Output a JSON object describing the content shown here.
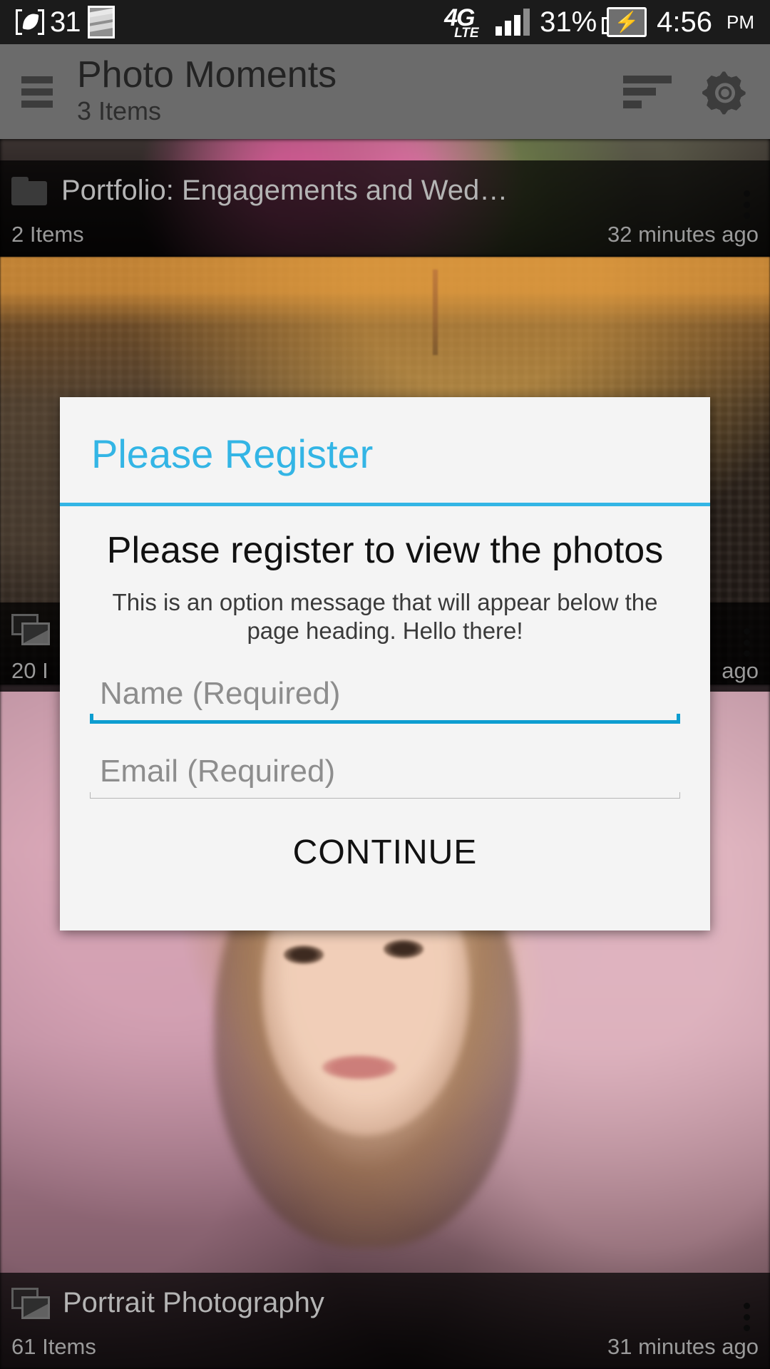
{
  "status_bar": {
    "leaf_icon": "leaf-bracket-icon",
    "notification_count": "31",
    "sd_card_icon": "sd-card-icon",
    "network_type": "4G",
    "network_sub": "LTE",
    "signal_icon": "signal-bars-icon",
    "battery_percent": "31%",
    "battery_icon": "battery-charging-icon",
    "time": "4:56",
    "am_pm": "PM"
  },
  "app_bar": {
    "menu_icon": "hamburger-menu-icon",
    "title": "Photo Moments",
    "subtitle": "3 Items",
    "sort_icon": "sort-icon",
    "settings_icon": "gear-icon"
  },
  "list": {
    "rows": [
      {
        "icon": "folder-icon",
        "title": "Portfolio: Engagements and Wed…",
        "count": "2 Items",
        "time": "32 minutes ago",
        "overflow_icon": "overflow-menu-icon"
      },
      {
        "icon": "album-stack-icon",
        "title": "",
        "count": "20 I",
        "time": "ago",
        "overflow_icon": "overflow-menu-icon"
      },
      {
        "icon": "album-stack-icon",
        "title": "Portrait Photography",
        "count": "61 Items",
        "time": "31 minutes ago",
        "overflow_icon": "overflow-menu-icon"
      }
    ]
  },
  "dialog": {
    "title": "Please Register",
    "message": "Please register to view the photos",
    "sub_message": "This is an option message that will appear below the page heading. Hello there!",
    "fields": [
      {
        "name": "name",
        "value": "",
        "placeholder": "Name (Required)",
        "focused": true
      },
      {
        "name": "email",
        "value": "",
        "placeholder": "Email (Required)",
        "focused": false
      }
    ],
    "continue_label": "CONTINUE"
  },
  "colors": {
    "accent": "#33b5e5",
    "accent_focus": "#0d9dd0",
    "dialog_bg": "#f4f4f4",
    "appbar_bg": "#6b6b6b",
    "statusbar_bg": "#1b1b1b"
  }
}
